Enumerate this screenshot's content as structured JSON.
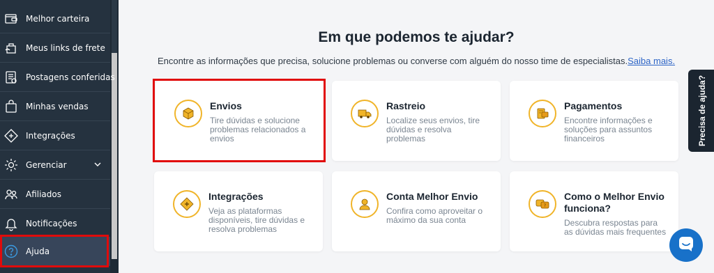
{
  "sidebar": {
    "items": [
      {
        "label": "Melhor carteira",
        "icon": "wallet-icon"
      },
      {
        "label": "Meus links de frete",
        "icon": "links-icon"
      },
      {
        "label": "Postagens conferidas",
        "icon": "document-icon"
      },
      {
        "label": "Minhas vendas",
        "icon": "bag-icon"
      },
      {
        "label": "Integrações",
        "icon": "puzzle-icon"
      },
      {
        "label": "Gerenciar",
        "icon": "gear-icon"
      },
      {
        "label": "Afiliados",
        "icon": "people-icon"
      },
      {
        "label": "Notificações",
        "icon": "bell-icon"
      },
      {
        "label": "Ajuda",
        "icon": "help-icon"
      }
    ]
  },
  "main": {
    "title": "Em que podemos te ajudar?",
    "subtitle": "Encontre as informações que precisa, solucione problemas ou converse com alguém do nosso time de especialistas.",
    "subtitle_link": "Saiba mais.",
    "cards": [
      {
        "title": "Envios",
        "desc": "Tire dúvidas e solucione problemas relacionados a envios",
        "icon": "box-icon"
      },
      {
        "title": "Rastreio",
        "desc": "Localize seus envios, tire dúvidas e resolva problemas",
        "icon": "truck-icon"
      },
      {
        "title": "Pagamentos",
        "desc": "Encontre informações e soluções para assuntos financeiros",
        "icon": "payment-icon"
      },
      {
        "title": "Integrações",
        "desc": "Veja as plataformas disponíveis, tire dúvidas e resolva problemas",
        "icon": "puzzle-icon"
      },
      {
        "title": "Conta Melhor Envio",
        "desc": "Confira como aproveitar o máximo da sua conta",
        "icon": "account-icon"
      },
      {
        "title": "Como o Melhor Envio funciona?",
        "desc": "Descubra respostas para as dúvidas mais frequentes",
        "icon": "faq-icon"
      }
    ]
  },
  "help_tab": "Precisa de ajuda?",
  "colors": {
    "sidebar": "#25323f",
    "accent": "#f0b429",
    "highlight": "#e10b0b",
    "chat": "#1871c9",
    "link": "#2c64c6"
  }
}
